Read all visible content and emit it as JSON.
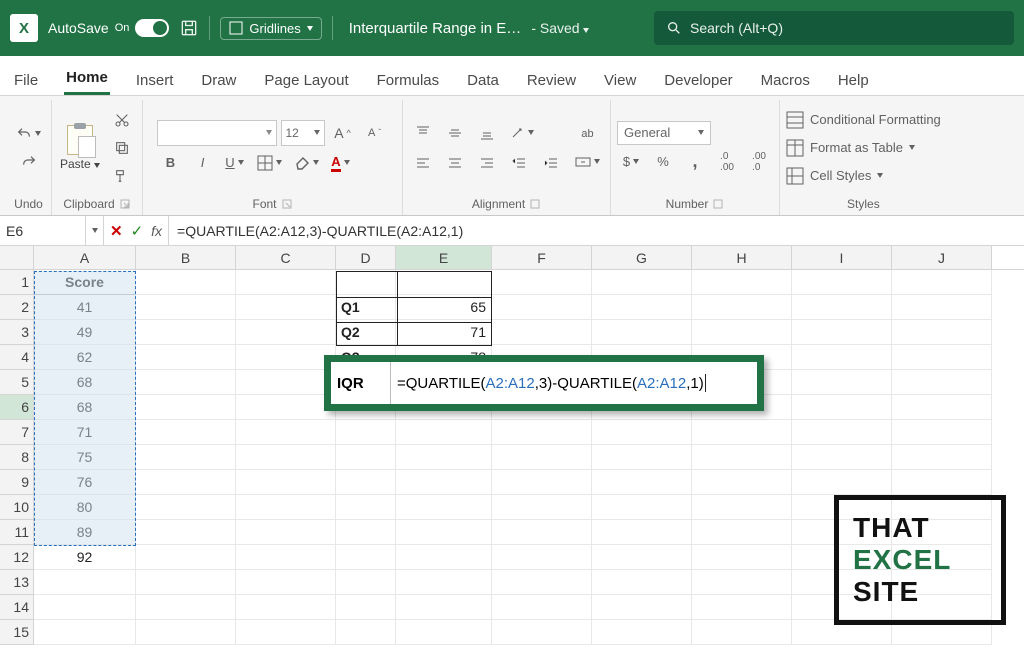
{
  "titlebar": {
    "logo_text": "X",
    "autosave_label": "AutoSave",
    "autosave_state": "On",
    "gridlines_label": "Gridlines",
    "doc_title": "Interquartile Range in E…",
    "saved_label": "- Saved",
    "search_placeholder": "Search (Alt+Q)"
  },
  "ribbon": {
    "tabs": [
      "File",
      "Home",
      "Insert",
      "Draw",
      "Page Layout",
      "Formulas",
      "Data",
      "Review",
      "View",
      "Developer",
      "Macros",
      "Help"
    ],
    "active_tab": "Home",
    "groups": {
      "undo": "Undo",
      "clipboard": "Clipboard",
      "font": "Font",
      "alignment": "Alignment",
      "number": "Number",
      "styles": "Styles"
    },
    "paste_label": "Paste",
    "font_size": "12",
    "number_format": "General",
    "cond_fmt": "Conditional Formatting",
    "fmt_table": "Format as Table",
    "cell_styles": "Cell Styles",
    "bold": "B",
    "italic": "I",
    "underline": "U",
    "wrap": "ab"
  },
  "fbar": {
    "cell_ref": "E6",
    "formula": "=QUARTILE(A2:A12,3)-QUARTILE(A2:A12,1)"
  },
  "columns": [
    "A",
    "B",
    "C",
    "D",
    "E",
    "F",
    "G",
    "H",
    "I",
    "J"
  ],
  "rows": [
    "1",
    "2",
    "3",
    "4",
    "5",
    "6",
    "7",
    "8",
    "9",
    "10",
    "11",
    "12",
    "13",
    "14",
    "15"
  ],
  "sheet": {
    "A1": "Score",
    "scores": [
      "41",
      "49",
      "62",
      "68",
      "68",
      "71",
      "75",
      "76",
      "80",
      "89",
      "92"
    ],
    "D2": "Q1",
    "E2": "65",
    "D3": "Q2",
    "E3": "71",
    "D4": "Q3",
    "E4": "78",
    "D6": "IQR",
    "E6_formula_prefix1": "=QUARTILE(",
    "E6_ref1": "A2:A12",
    "E6_mid1": ",3)-QUARTILE(",
    "E6_ref2": "A2:A12",
    "E6_suffix": ",1)"
  },
  "logo": {
    "line1": "THAT",
    "line2": "EXCEL",
    "line3": "SITE"
  },
  "chart_data": {
    "type": "table",
    "title": "Interquartile Range",
    "categories": [
      "Q1",
      "Q2",
      "Q3"
    ],
    "values": [
      65,
      71,
      78
    ],
    "raw_scores": [
      41,
      49,
      62,
      68,
      68,
      71,
      75,
      76,
      80,
      89,
      92
    ],
    "iqr_formula": "=QUARTILE(A2:A12,3)-QUARTILE(A2:A12,1)"
  }
}
